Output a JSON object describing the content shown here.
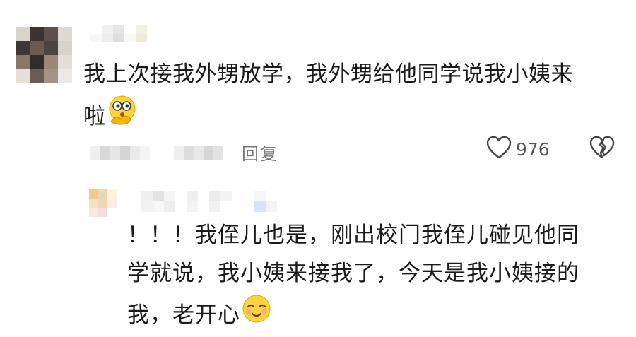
{
  "comment": {
    "text_line1": "我上次接我外甥放学，我外甥给他同学说我小姨来",
    "text_line2": "啦",
    "emoji": "thinking-face-emoji",
    "reply_label": "回复",
    "like_count": "976"
  },
  "reply": {
    "line1": "！！！我侄儿也是，刚出校门我侄儿碰见他同",
    "line2": "学就说，我小姨来接我了，今天是我小姨接的",
    "line3": "我，老开心",
    "emoji": "smiling-face-emoji"
  },
  "colors": {
    "text": "#1a1a1a",
    "meta_gray": "#777777",
    "emoji_yellow": "#ffd23f"
  }
}
